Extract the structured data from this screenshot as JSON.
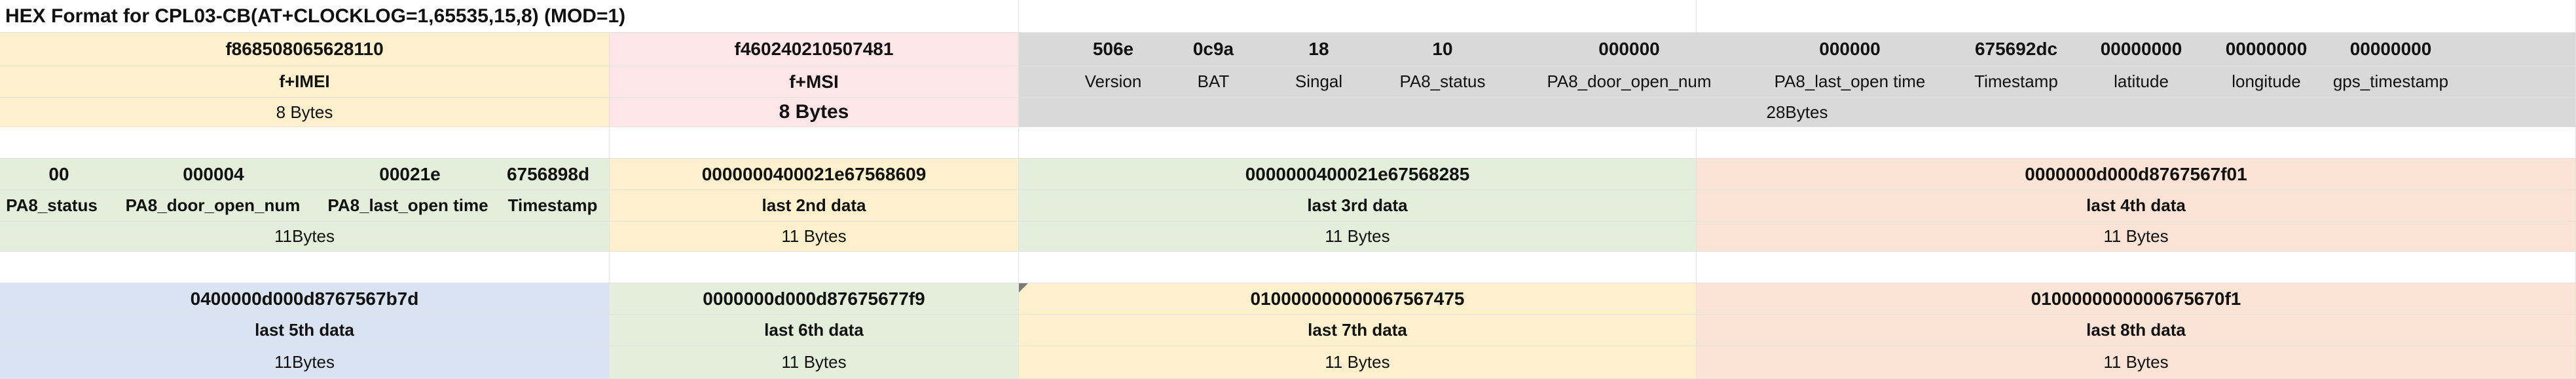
{
  "title": "HEX Format for CPL03-CB(AT+CLOCKLOG=1,65535,15,8)  (MOD=1)",
  "header": {
    "imei_hex": "f868508065628110",
    "imei_label": "f+IMEI",
    "imei_size": "8 Bytes",
    "imsi_hex": "f460240210507481",
    "imsi_label": "f+MSI",
    "imsi_size": "8 Bytes",
    "fields": [
      {
        "hex": "506e",
        "label": "Version"
      },
      {
        "hex": "0c9a",
        "label": "BAT"
      },
      {
        "hex": "18",
        "label": "Singal"
      },
      {
        "hex": "10",
        "label": "PA8_status"
      },
      {
        "hex": "000000",
        "label": "PA8_door_open_num"
      },
      {
        "hex": "000000",
        "label": "PA8_last_open time"
      },
      {
        "hex": "675692dc",
        "label": "Timestamp"
      },
      {
        "hex": "00000000",
        "label": "latitude"
      },
      {
        "hex": "00000000",
        "label": "longitude"
      },
      {
        "hex": "00000000",
        "label": "gps_timestamp"
      }
    ],
    "fields_size": "28Bytes"
  },
  "row2": {
    "first": {
      "fields": [
        {
          "hex": "00",
          "label": "PA8_status"
        },
        {
          "hex": "000004",
          "label": "PA8_door_open_num"
        },
        {
          "hex": "00021e",
          "label": "PA8_last_open time"
        },
        {
          "hex": "6756898d",
          "label": "Timestamp"
        }
      ],
      "size": "11Bytes"
    },
    "blocks": [
      {
        "hex": "0000000400021e67568609",
        "label": "last 2nd data",
        "size": "11 Bytes"
      },
      {
        "hex": "0000000400021e67568285",
        "label": "last 3rd data",
        "size": "11 Bytes"
      },
      {
        "hex": "0000000d000d8767567f01",
        "label": "last 4th data",
        "size": "11 Bytes"
      }
    ]
  },
  "row3": {
    "blocks": [
      {
        "hex": "0400000d000d8767567b7d",
        "label": "last 5th data",
        "size": "11Bytes"
      },
      {
        "hex": "0000000d000d87675677f9",
        "label": "last 6th data",
        "size": "11 Bytes"
      },
      {
        "hex": "010000000000067567475",
        "label": "last 7th data",
        "size": "11 Bytes"
      },
      {
        "hex": "0100000000000675670f1",
        "label": "last 8th data",
        "size": "11 Bytes"
      }
    ]
  },
  "colors": {
    "yellow": "#fdf1cd",
    "pink": "#fde5e8",
    "gray": "#d9d9d9",
    "green": "#e3eedb",
    "orange": "#fbe4d6",
    "blue": "#dae3f2"
  }
}
